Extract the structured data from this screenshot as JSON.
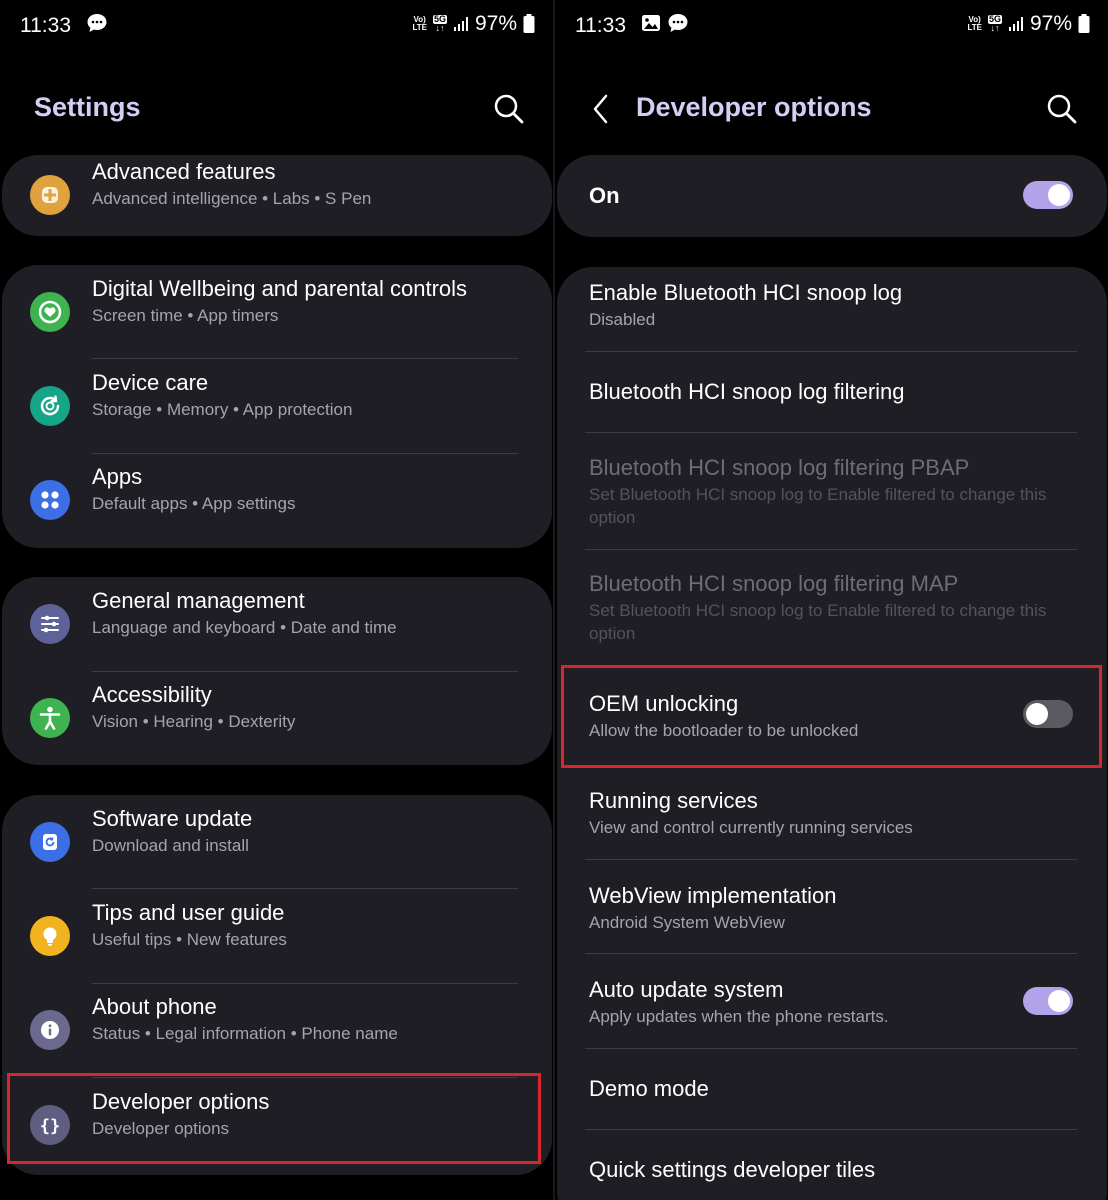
{
  "left": {
    "status": {
      "time": "11:33",
      "icons": [
        "message-icon"
      ],
      "battery": "97%"
    },
    "title": "Settings",
    "groups": [
      {
        "items": [
          {
            "title": "Advanced features",
            "subtitle": "Advanced intelligence  •  Labs  •  S Pen",
            "icon": "plus-gear-icon",
            "color": "#e0a23c"
          }
        ]
      },
      {
        "items": [
          {
            "title": "Digital Wellbeing and parental controls",
            "subtitle": "Screen time  •  App timers",
            "icon": "heart-circle-icon",
            "color": "#3fb34f"
          },
          {
            "title": "Device care",
            "subtitle": "Storage  •  Memory  •  App protection",
            "icon": "refresh-circle-icon",
            "color": "#17a589"
          },
          {
            "title": "Apps",
            "subtitle": "Default apps  •  App settings",
            "icon": "apps-grid-icon",
            "color": "#3c6ee6"
          }
        ]
      },
      {
        "items": [
          {
            "title": "General management",
            "subtitle": "Language and keyboard  •  Date and time",
            "icon": "sliders-icon",
            "color": "#5f6299"
          },
          {
            "title": "Accessibility",
            "subtitle": "Vision  •  Hearing  •  Dexterity",
            "icon": "accessibility-icon",
            "color": "#3fb34f"
          }
        ]
      },
      {
        "items": [
          {
            "title": "Software update",
            "subtitle": "Download and install",
            "icon": "update-icon",
            "color": "#3c6ee6"
          },
          {
            "title": "Tips and user guide",
            "subtitle": "Useful tips  •  New features",
            "icon": "lightbulb-icon",
            "color": "#f2b320"
          },
          {
            "title": "About phone",
            "subtitle": "Status  •  Legal information  •  Phone name",
            "icon": "info-icon",
            "color": "#6b6a8e"
          },
          {
            "title": "Developer options",
            "subtitle": "Developer options",
            "icon": "braces-icon",
            "color": "#5f5d80"
          }
        ]
      }
    ]
  },
  "right": {
    "status": {
      "time": "11:33",
      "icons": [
        "gallery-icon",
        "message-icon"
      ],
      "battery": "97%"
    },
    "title": "Developer options",
    "master": {
      "label": "On",
      "toggle": "on"
    },
    "items": [
      {
        "title": "Enable Bluetooth HCI snoop log",
        "subtitle": "Disabled"
      },
      {
        "title": "Bluetooth HCI snoop log filtering",
        "subtitle": ""
      },
      {
        "title": "Bluetooth HCI snoop log filtering PBAP",
        "subtitle": "Set Bluetooth HCI snoop log to Enable filtered to change this option",
        "disabled": true
      },
      {
        "title": "Bluetooth HCI snoop log filtering MAP",
        "subtitle": "Set Bluetooth HCI snoop log to Enable filtered to change this option",
        "disabled": true
      },
      {
        "title": "OEM unlocking",
        "subtitle": "Allow the bootloader to be unlocked",
        "toggle": "off"
      },
      {
        "title": "Running services",
        "subtitle": "View and control currently running services"
      },
      {
        "title": "WebView implementation",
        "subtitle": "Android System WebView"
      },
      {
        "title": "Auto update system",
        "subtitle": "Apply updates when the phone restarts.",
        "toggle": "on"
      },
      {
        "title": "Demo mode",
        "subtitle": ""
      },
      {
        "title": "Quick settings developer tiles",
        "subtitle": ""
      }
    ]
  }
}
